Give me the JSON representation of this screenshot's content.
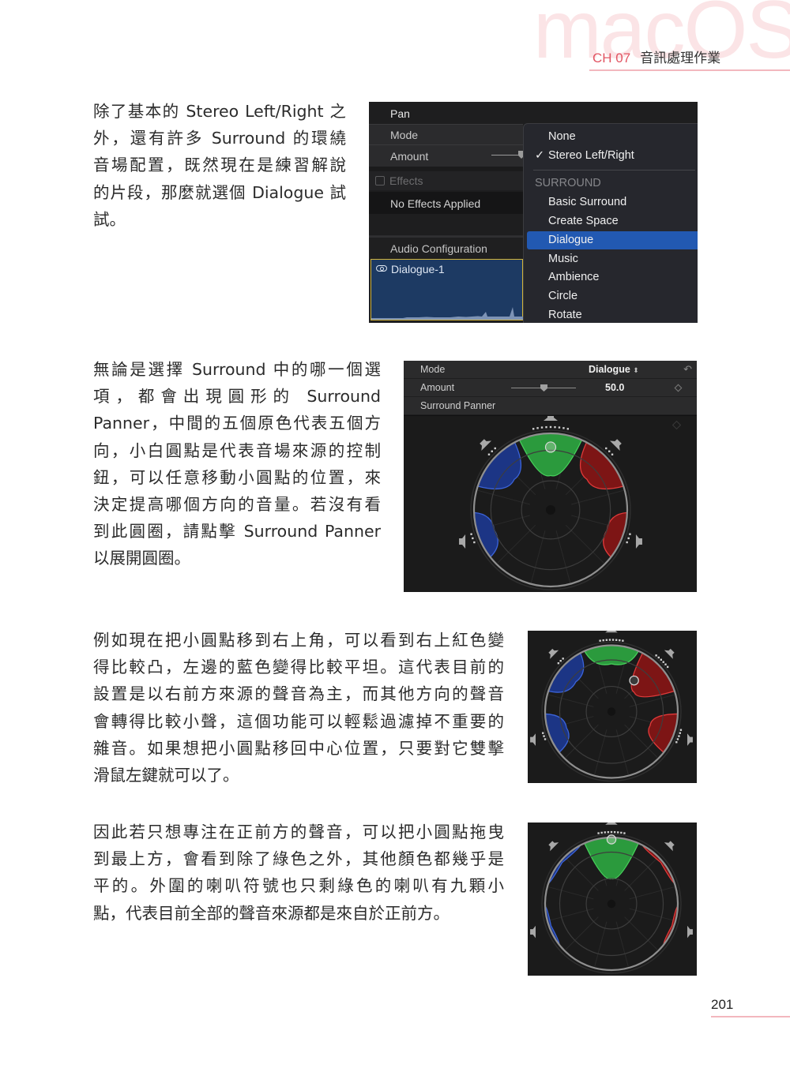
{
  "header": {
    "watermark": "macOS",
    "chapter_number": "CH 07",
    "chapter_title": "音訊處理作業"
  },
  "paragraphs": [
    {
      "lines": [
        "除了基本的 Stereo Left/Right 之",
        "外，還有許多 Surround 的環繞",
        "音場配置，既然現在是練習解說",
        "的片段，那麼就選個 Dialogue 試",
        "試。"
      ]
    },
    {
      "lines": [
        "無論是選擇 Surround 中的哪一個選",
        "項，都會出現圓形的 Surround",
        "Panner，中間的五個原色代表五個方",
        "向，小白圓點是代表音場來源的控制",
        "鈕，可以任意移動小圓點的位置，來",
        "決定提高哪個方向的音量。若沒有看",
        "到此圓圈，請點擊 Surround Panner",
        "以展開圓圈。"
      ]
    },
    {
      "lines": [
        "例如現在把小圓點移到右上角，可以看到右上紅色變",
        "得比較凸，左邊的藍色變得比較平坦。這代表目前的",
        "設置是以右前方來源的聲音為主，而其他方向的聲音",
        "會轉得比較小聲，這個功能可以輕鬆過濾掉不重要的",
        "雜音。如果想把小圓點移回中心位置，只要對它雙擊",
        "滑鼠左鍵就可以了。"
      ]
    },
    {
      "lines": [
        "因此若只想專注在正前方的聲音，可以把小圓點拖曳",
        "到最上方，會看到除了綠色之外，其他顏色都幾乎是",
        "平的。外圍的喇叭符號也只剩綠色的喇叭有九顆小",
        "點，代表目前全部的聲音來源都是來自於正前方。"
      ]
    }
  ],
  "screenshot_pan_menu": {
    "section_title": "Pan",
    "mode_label": "Mode",
    "amount_label": "Amount",
    "effects_label": "Effects",
    "effects_checked": false,
    "no_effects_label": "No Effects Applied",
    "audio_config_label": "Audio Configuration",
    "clip_name": "Dialogue-1",
    "clip_icon": "link-icon",
    "menu": {
      "items": [
        {
          "label": "None",
          "type": "item",
          "checked": false,
          "selected": false
        },
        {
          "label": "Stereo Left/Right",
          "type": "item",
          "checked": true,
          "selected": false
        },
        {
          "label": "SURROUND",
          "type": "header"
        },
        {
          "label": "Basic Surround",
          "type": "item",
          "checked": false,
          "selected": false
        },
        {
          "label": "Create Space",
          "type": "item",
          "checked": false,
          "selected": false
        },
        {
          "label": "Dialogue",
          "type": "item",
          "checked": false,
          "selected": true
        },
        {
          "label": "Music",
          "type": "item",
          "checked": false,
          "selected": false
        },
        {
          "label": "Ambience",
          "type": "item",
          "checked": false,
          "selected": false
        },
        {
          "label": "Circle",
          "type": "item",
          "checked": false,
          "selected": false
        },
        {
          "label": "Rotate",
          "type": "item",
          "checked": false,
          "selected": false
        }
      ],
      "check_glyph": "✓",
      "selected_color": "#2259b2"
    }
  },
  "screenshot_surround_panel": {
    "mode_label": "Mode",
    "mode_value": "Dialogue",
    "mode_stepper_glyph": "⌃⌄",
    "reset_icon": "↶",
    "amount_label": "Amount",
    "amount_value": "50.0",
    "amount_fraction": 0.45,
    "surround_panner_label": "Surround Panner"
  },
  "panners": [
    {
      "id": "default",
      "puck": {
        "angle_deg": 0,
        "radius_fraction": 0.82
      },
      "lobes": {
        "green": 0.55,
        "blue_front": 0.38,
        "red_front": 0.38,
        "blue_rear": 0.22,
        "red_rear": 0.22
      }
    },
    {
      "id": "front-right",
      "puck": {
        "angle_deg": 36,
        "radius_fraction": 0.58
      },
      "lobes": {
        "green": 0.28,
        "blue_front": 0.3,
        "red_front": 0.55,
        "blue_rear": 0.28,
        "red_rear": 0.38
      }
    },
    {
      "id": "front-only",
      "puck": {
        "angle_deg": 0,
        "radius_fraction": 0.97
      },
      "lobes": {
        "green": 0.62,
        "blue_front": 0.03,
        "red_front": 0.03,
        "blue_rear": 0.03,
        "red_rear": 0.03
      }
    }
  ],
  "colors": {
    "accent_pink": "#e25563",
    "green_lobe": "#2fa843",
    "blue_lobe": "#1d3a8f",
    "red_lobe": "#8c1818"
  },
  "footer": {
    "page_number": "201"
  }
}
